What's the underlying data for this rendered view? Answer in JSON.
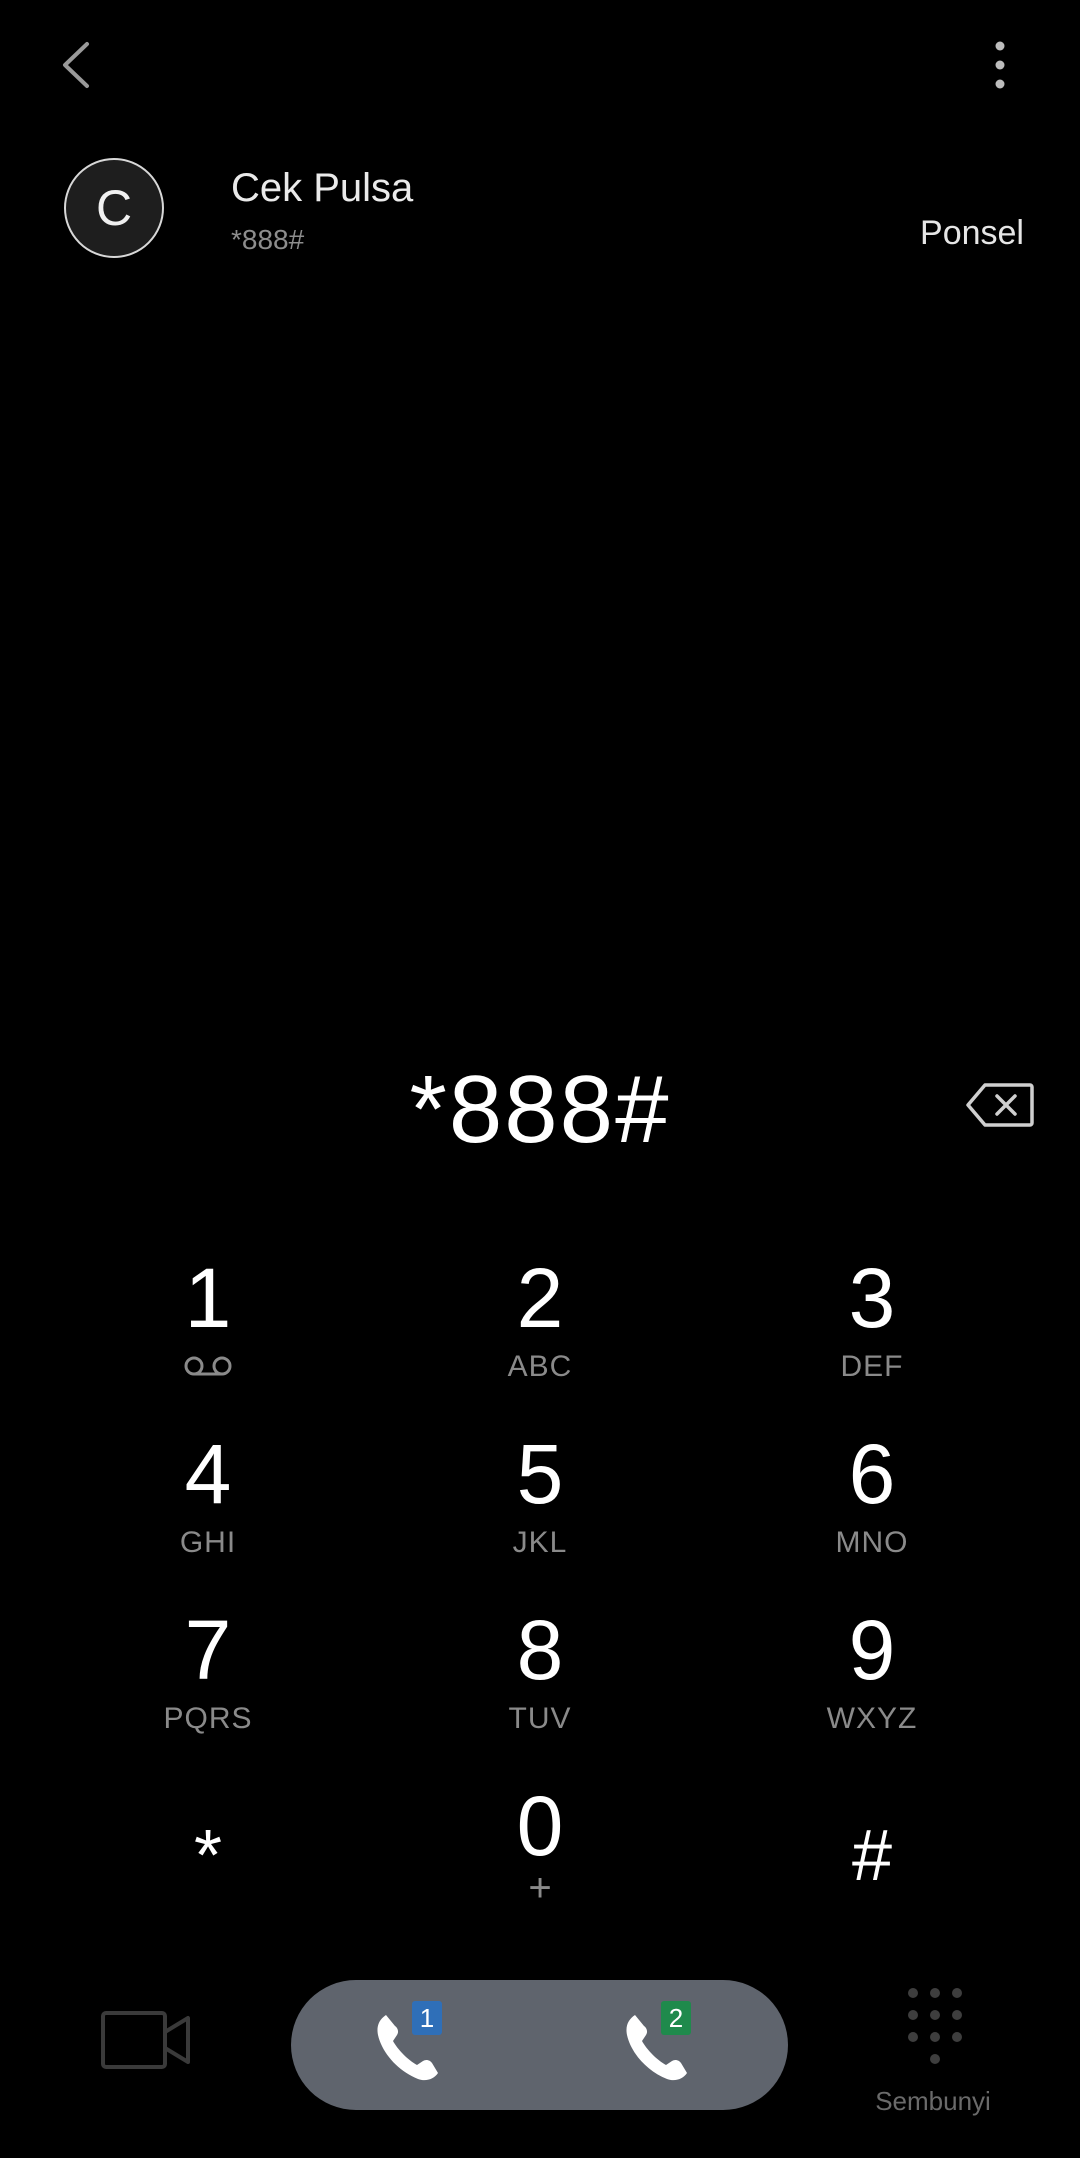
{
  "contact": {
    "avatar_letter": "C",
    "name": "Cek Pulsa",
    "number": "*888#",
    "type": "Ponsel"
  },
  "dialer": {
    "entered_number": "*888#"
  },
  "keypad": {
    "keys": [
      {
        "digit": "1",
        "letters": ""
      },
      {
        "digit": "2",
        "letters": "ABC"
      },
      {
        "digit": "3",
        "letters": "DEF"
      },
      {
        "digit": "4",
        "letters": "GHI"
      },
      {
        "digit": "5",
        "letters": "JKL"
      },
      {
        "digit": "6",
        "letters": "MNO"
      },
      {
        "digit": "7",
        "letters": "PQRS"
      },
      {
        "digit": "8",
        "letters": "TUV"
      },
      {
        "digit": "9",
        "letters": "WXYZ"
      },
      {
        "digit": "*",
        "letters": ""
      },
      {
        "digit": "0",
        "letters": "+"
      },
      {
        "digit": "#",
        "letters": ""
      }
    ]
  },
  "bottom_bar": {
    "sim1_label": "1",
    "sim2_label": "2",
    "hide_label": "Sembunyi"
  },
  "colors": {
    "background": "#000000",
    "call_pill": "#5f646d",
    "sim1_badge": "#2f6fb8",
    "sim2_badge": "#1f8a4c"
  },
  "icons": {
    "back": "chevron-left-icon",
    "more": "more-vertical-icon",
    "backspace": "backspace-icon",
    "voicemail": "voicemail-icon",
    "video": "video-camera-icon",
    "call": "phone-icon",
    "hide_keypad": "keypad-grid-icon"
  }
}
